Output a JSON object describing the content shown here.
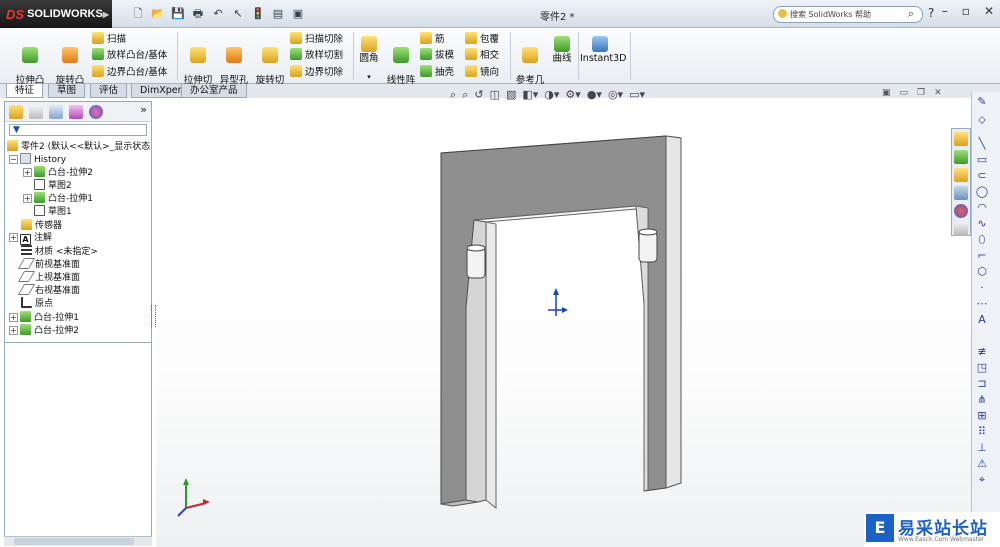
{
  "app": {
    "logo_text": "SOLIDWORKS",
    "logo_prefix": "DS",
    "document_title": "零件2 *",
    "search_placeholder": "搜索 SolidWorks 帮助"
  },
  "ribbon": {
    "extrude_boss": "拉伸凸\n台/基体",
    "revolve_boss": "旋转凸\n台/基体",
    "sweep": "扫描",
    "loft_boss": "放样凸台/基体",
    "boundary_boss": "边界凸台/基体",
    "extrude_cut": "拉伸切\n除",
    "hole_wizard": "异型孔\n向导",
    "revolve_cut": "旋转切\n除",
    "sweep_cut": "扫描切除",
    "loft_cut": "放样切割",
    "boundary_cut": "边界切除",
    "fillet": "圆角",
    "linear_pattern": "线性阵\n列",
    "rib": "筋",
    "draft": "拔模",
    "shell": "抽壳",
    "wrap": "包覆",
    "intersect": "相交",
    "mirror": "镜向",
    "ref_geometry": "参考几\n何体",
    "curves": "曲线",
    "instant3d": "Instant3D"
  },
  "tabs": [
    "特征",
    "草图",
    "评估",
    "DimXpert",
    "办公室产品"
  ],
  "tree": {
    "root": "零件2 (默认<<默认>_显示状态",
    "history": "History",
    "history_items": [
      "凸台-拉伸2",
      "草图2",
      "凸台-拉伸1",
      "草图1"
    ],
    "sensors": "传感器",
    "annotations": "注解",
    "material": "材质 <未指定>",
    "front_plane": "前视基准面",
    "top_plane": "上视基准面",
    "right_plane": "右视基准面",
    "origin": "原点",
    "features": [
      "凸台-拉伸1",
      "凸台-拉伸2"
    ]
  },
  "watermark": {
    "text": "易采站长站",
    "sub": "Www.Easck.Com Webmaster"
  }
}
